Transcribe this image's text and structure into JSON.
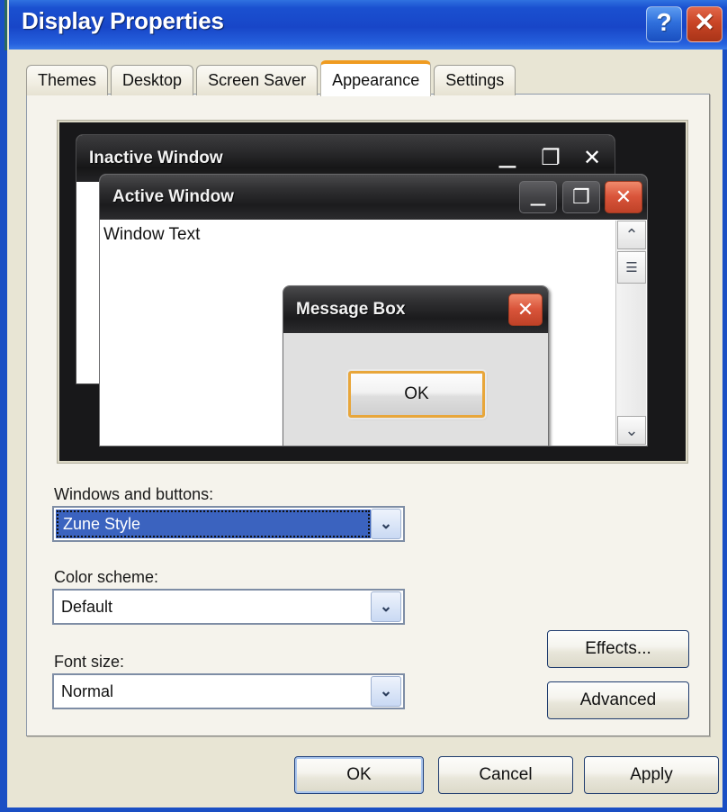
{
  "window": {
    "title": "Display Properties",
    "help_button": "?",
    "close_button": "✕"
  },
  "tabs": [
    {
      "label": "Themes",
      "active": false
    },
    {
      "label": "Desktop",
      "active": false
    },
    {
      "label": "Screen Saver",
      "active": false
    },
    {
      "label": "Appearance",
      "active": true
    },
    {
      "label": "Settings",
      "active": false
    }
  ],
  "preview": {
    "inactive_window": {
      "title": "Inactive Window",
      "minimize": "–",
      "maximize": "❐",
      "close": "✕"
    },
    "active_window": {
      "title": "Active Window",
      "body_text": "Window Text",
      "minimize": "–",
      "maximize": "❐",
      "close": "✕"
    },
    "message_box": {
      "title": "Message Box",
      "close": "✕",
      "ok_label": "OK"
    },
    "scrollbar": {
      "up_arrow": "⌃",
      "thumb_grip": "☰",
      "down_arrow": "⌄"
    }
  },
  "form": {
    "windows_and_buttons": {
      "label": "Windows and buttons:",
      "value": "Zune Style",
      "arrow": "⌄"
    },
    "color_scheme": {
      "label": "Color scheme:",
      "value": "Default",
      "arrow": "⌄"
    },
    "font_size": {
      "label": "Font size:",
      "value": "Normal",
      "arrow": "⌄"
    },
    "effects_button": "Effects...",
    "advanced_button": "Advanced"
  },
  "footer": {
    "ok": "OK",
    "cancel": "Cancel",
    "apply": "Apply"
  },
  "colors": {
    "titlebar_blue": "#1a50d0",
    "close_red": "#c94526",
    "accent_orange": "#ef9b20",
    "selection_blue": "#3b63bf",
    "dialog_bg": "#e8e5d4",
    "panel_bg": "#f5f3ec"
  }
}
